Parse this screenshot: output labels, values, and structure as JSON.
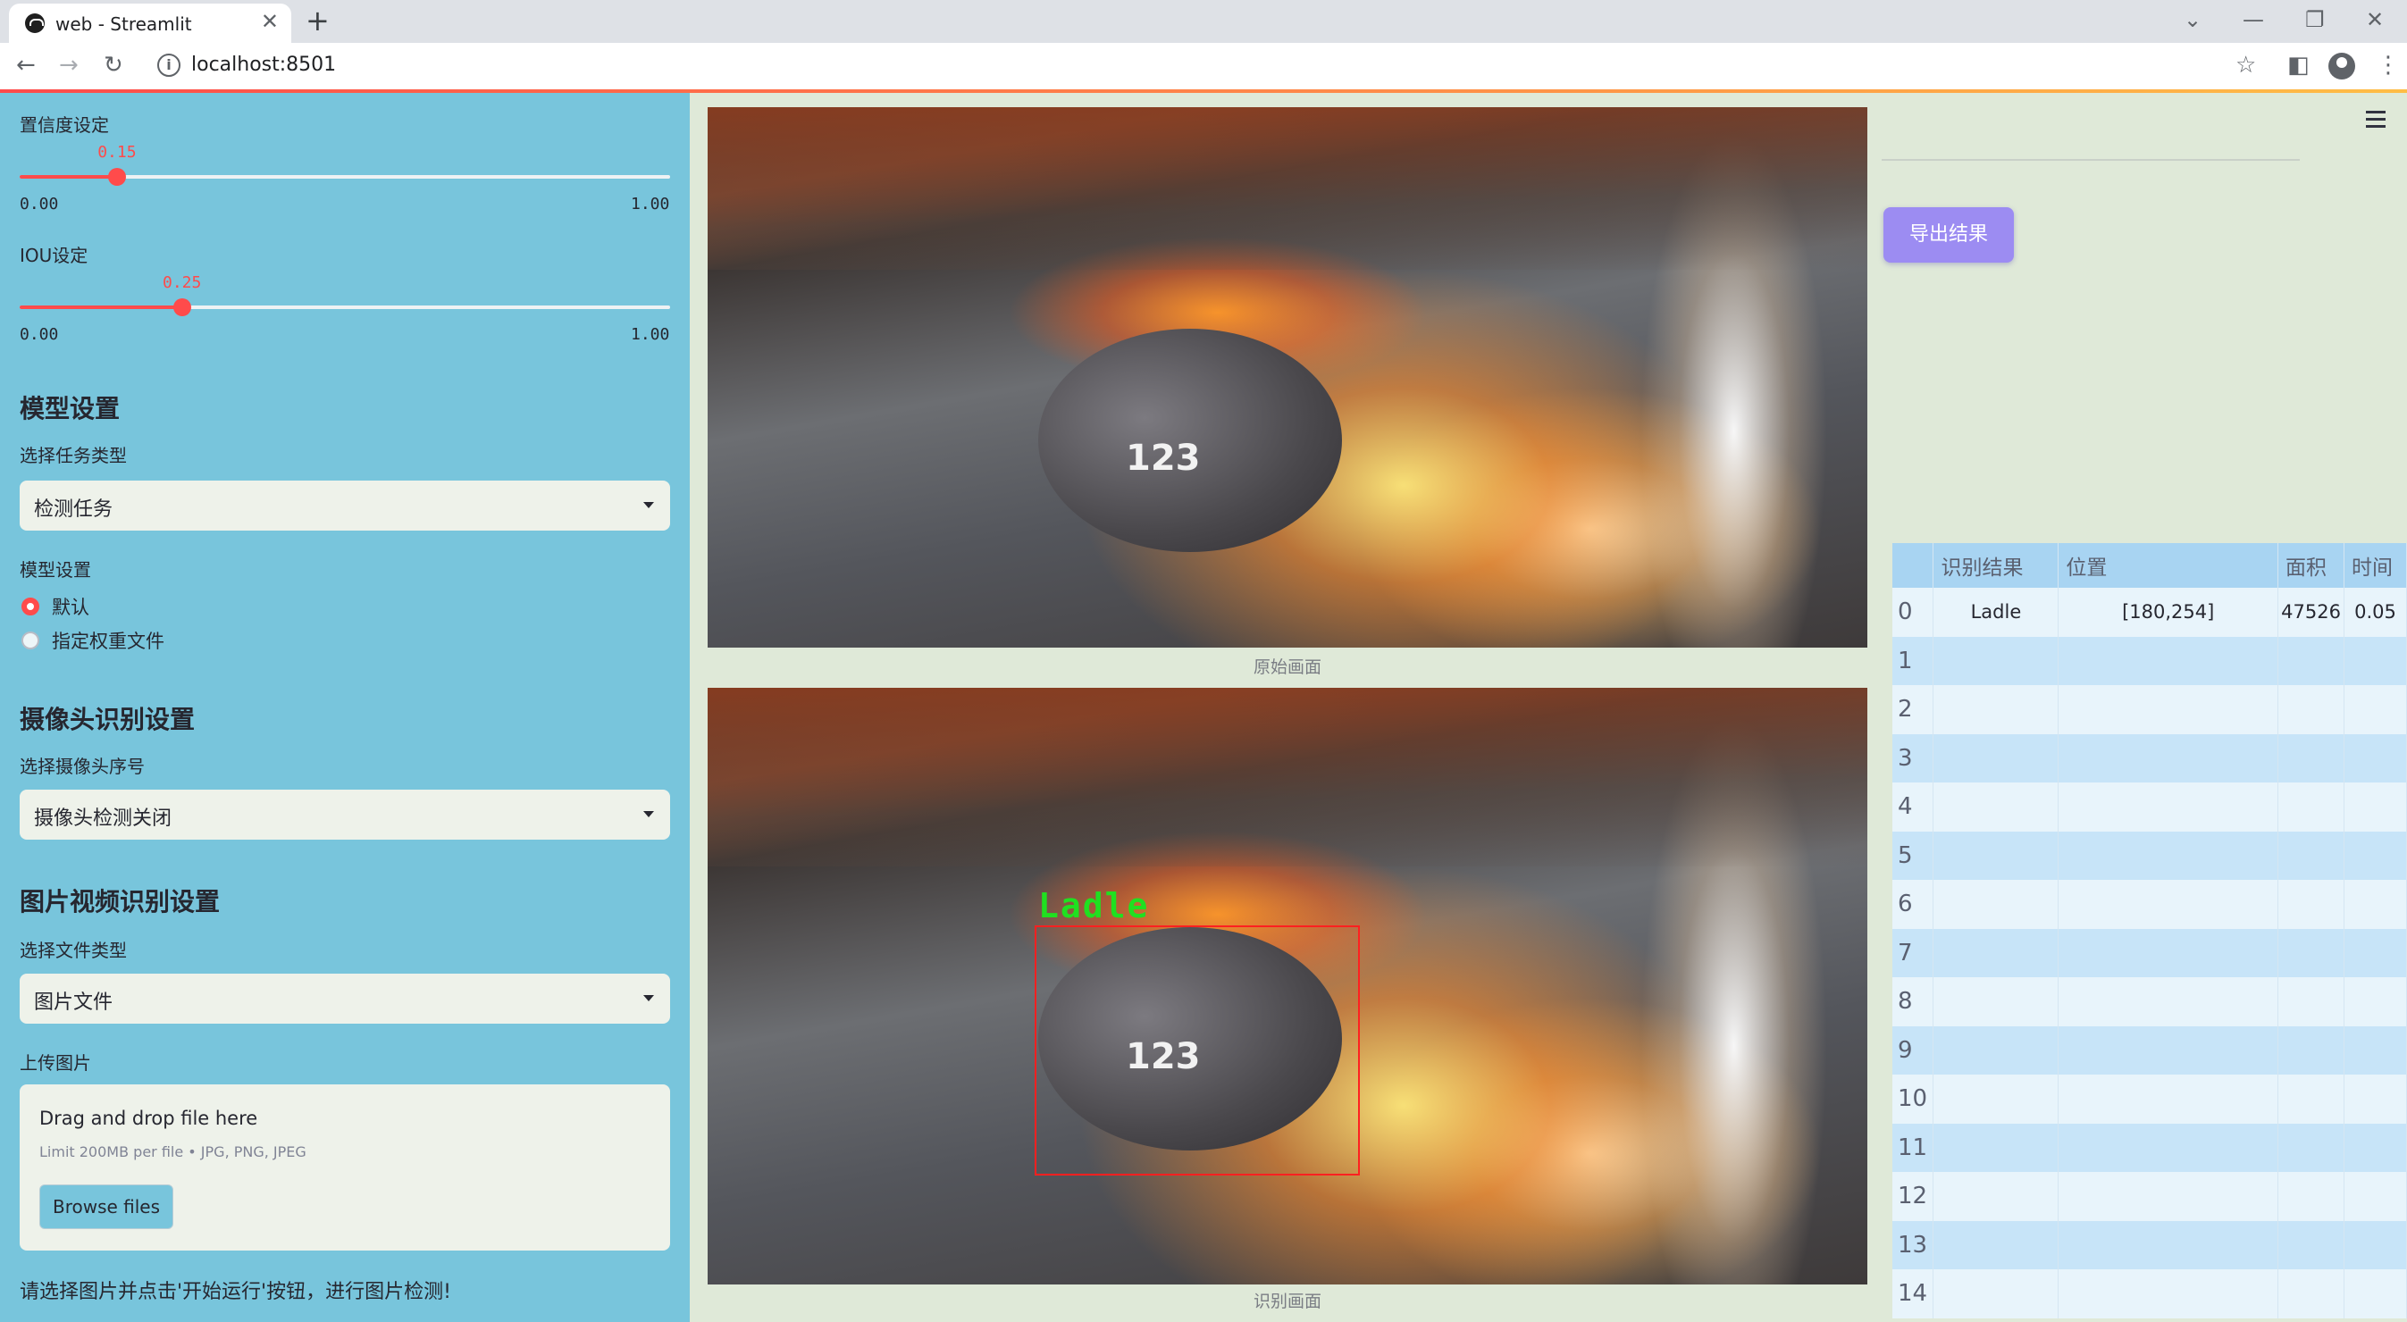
{
  "browser": {
    "tab_title": "web - Streamlit",
    "tab_close": "✕",
    "new_tab": "+",
    "url": "localhost:8501",
    "icons": {
      "back": "←",
      "forward": "→",
      "reload": "↻",
      "info": "i",
      "star": "☆",
      "sidepanel": "◧",
      "menu": "⋮",
      "chevron": "⌄",
      "minimize": "—",
      "restore": "❐",
      "close": "✕"
    }
  },
  "sidebar": {
    "confidence_label": "置信度设定",
    "confidence_value": "0.15",
    "confidence_min": "0.00",
    "confidence_max": "1.00",
    "confidence_fraction": 0.15,
    "iou_label": "IOU设定",
    "iou_value": "0.25",
    "iou_min": "0.00",
    "iou_max": "1.00",
    "iou_fraction": 0.25,
    "model_heading": "模型设置",
    "task_label": "选择任务类型",
    "task_value": "检测任务",
    "model_label": "模型设置",
    "model_options": [
      "默认",
      "指定权重文件"
    ],
    "model_selected": "默认",
    "camera_heading": "摄像头识别设置",
    "camera_label": "选择摄像头序号",
    "camera_value": "摄像头检测关闭",
    "media_heading": "图片视频识别设置",
    "filetype_label": "选择文件类型",
    "filetype_value": "图片文件",
    "upload_label": "上传图片",
    "upload_title": "Drag and drop file here",
    "upload_limit": "Limit 200MB per file • JPG, PNG, JPEG",
    "browse_button": "Browse files",
    "hint": "请选择图片并点击'开始运行'按钮，进行图片检测!"
  },
  "main": {
    "original_caption": "原始画面",
    "result_caption": "识别画面",
    "ladle_number": "123",
    "detection_label": "Ladle"
  },
  "panel": {
    "export_button": "导出结果",
    "table": {
      "columns": [
        "",
        "识别结果",
        "位置",
        "面积",
        "时间"
      ],
      "rows": [
        {
          "index": "0",
          "result": "Ladle",
          "position": "[180,254]",
          "area": "47526",
          "time": "0.05"
        },
        {
          "index": "1",
          "result": "",
          "position": "",
          "area": "",
          "time": ""
        },
        {
          "index": "2",
          "result": "",
          "position": "",
          "area": "",
          "time": ""
        },
        {
          "index": "3",
          "result": "",
          "position": "",
          "area": "",
          "time": ""
        },
        {
          "index": "4",
          "result": "",
          "position": "",
          "area": "",
          "time": ""
        },
        {
          "index": "5",
          "result": "",
          "position": "",
          "area": "",
          "time": ""
        },
        {
          "index": "6",
          "result": "",
          "position": "",
          "area": "",
          "time": ""
        },
        {
          "index": "7",
          "result": "",
          "position": "",
          "area": "",
          "time": ""
        },
        {
          "index": "8",
          "result": "",
          "position": "",
          "area": "",
          "time": ""
        },
        {
          "index": "9",
          "result": "",
          "position": "",
          "area": "",
          "time": ""
        },
        {
          "index": "10",
          "result": "",
          "position": "",
          "area": "",
          "time": ""
        },
        {
          "index": "11",
          "result": "",
          "position": "",
          "area": "",
          "time": ""
        },
        {
          "index": "12",
          "result": "",
          "position": "",
          "area": "",
          "time": ""
        },
        {
          "index": "13",
          "result": "",
          "position": "",
          "area": "",
          "time": ""
        },
        {
          "index": "14",
          "result": "",
          "position": "",
          "area": "",
          "time": ""
        }
      ]
    }
  },
  "colors": {
    "sidebar_bg": "#78c5dc",
    "main_bg": "#dfe9d8",
    "accent": "#ff4b4b",
    "export_button": "#9c8cf2",
    "table_header": "#a8d4f2",
    "detection_box": "#ff2020",
    "detection_label": "#20e020"
  }
}
